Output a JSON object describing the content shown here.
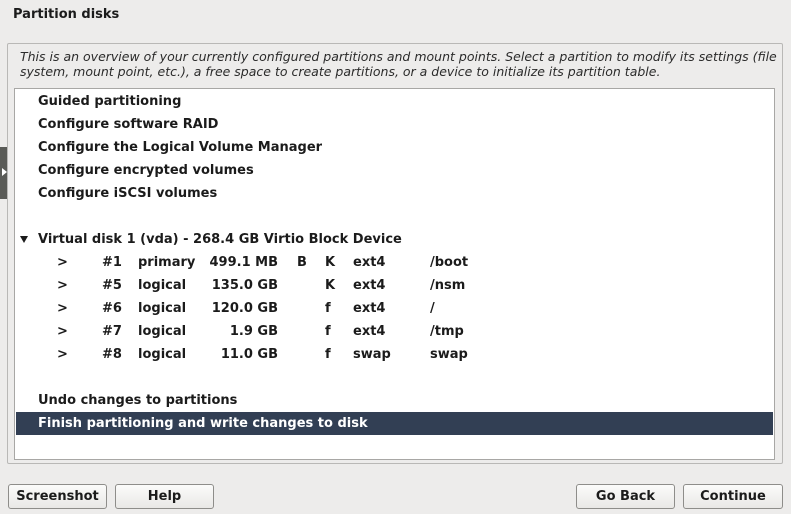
{
  "window": {
    "title": "Partition disks"
  },
  "description": "This is an overview of your currently configured partitions and mount points. Select a partition to modify its settings (file system, mount point, etc.), a free space to create partitions, or a device to initialize its partition table.",
  "menu_items": [
    "Guided partitioning",
    "Configure software RAID",
    "Configure the Logical Volume Manager",
    "Configure encrypted volumes",
    "Configure iSCSI volumes"
  ],
  "disk": {
    "label": "Virtual disk 1 (vda) - 268.4 GB Virtio Block Device",
    "partitions": [
      {
        "arrow": ">",
        "num": "#1",
        "type": "primary",
        "size": "499.1 MB",
        "flag1": "B",
        "flag2": "K",
        "fs": "ext4",
        "mount": "/boot"
      },
      {
        "arrow": ">",
        "num": "#5",
        "type": "logical",
        "size": "135.0 GB",
        "flag1": "",
        "flag2": "K",
        "fs": "ext4",
        "mount": "/nsm"
      },
      {
        "arrow": ">",
        "num": "#6",
        "type": "logical",
        "size": "120.0 GB",
        "flag1": "",
        "flag2": "f",
        "fs": "ext4",
        "mount": "/"
      },
      {
        "arrow": ">",
        "num": "#7",
        "type": "logical",
        "size": "1.9 GB",
        "flag1": "",
        "flag2": "f",
        "fs": "ext4",
        "mount": "/tmp"
      },
      {
        "arrow": ">",
        "num": "#8",
        "type": "logical",
        "size": "11.0 GB",
        "flag1": "",
        "flag2": "f",
        "fs": "swap",
        "mount": "swap"
      }
    ]
  },
  "actions": {
    "undo": "Undo changes to partitions",
    "finish": "Finish partitioning and write changes to disk"
  },
  "buttons": {
    "screenshot": "Screenshot",
    "help": "Help",
    "go_back": "Go Back",
    "continue": "Continue"
  },
  "colors": {
    "selection": "#323f54",
    "background": "#edeceb"
  }
}
